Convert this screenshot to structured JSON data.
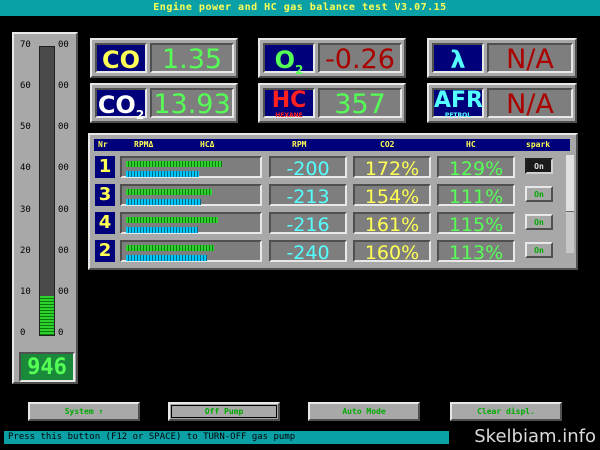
{
  "window": {
    "title": "Engine power and HC gas balance test  V3.07.15"
  },
  "gauge": {
    "left_ticks": [
      "70",
      "60",
      "50",
      "40",
      "30",
      "20",
      "10",
      "0"
    ],
    "right_ticks": [
      "00",
      "00",
      "00",
      "00",
      "00",
      "00",
      "00",
      "0"
    ],
    "readout": "946",
    "fill_fraction": 0.135
  },
  "readings": {
    "co": {
      "symbol": "CO",
      "value": "1.35"
    },
    "o2": {
      "symbol": "O",
      "sub": "2",
      "value": "-0.26"
    },
    "lambda": {
      "symbol": "λ",
      "value": "N/A"
    },
    "co2": {
      "symbol": "CO",
      "sub": "2",
      "value": "13.93"
    },
    "hc": {
      "symbol": "HC",
      "sub": "HEXANE",
      "value": "357"
    },
    "afr": {
      "symbol": "AFR",
      "sub": "PETROL",
      "value": "N/A"
    }
  },
  "table": {
    "headers": {
      "nr": "Nr",
      "rpm_delta": "RPMΔ",
      "hc_delta": "HCΔ",
      "rpm": "RPM",
      "co2": "CO2",
      "hc": "HC",
      "spark": "spark"
    },
    "rows": [
      {
        "nr": "1",
        "rpm": "-200",
        "co2": "172%",
        "hc": "129%",
        "spark": "On",
        "bar_rpm": 0.74,
        "bar_hc": 0.56,
        "active": true
      },
      {
        "nr": "3",
        "rpm": "-213",
        "co2": "154%",
        "hc": "111%",
        "spark": "On",
        "bar_rpm": 0.66,
        "bar_hc": 0.58,
        "active": false
      },
      {
        "nr": "4",
        "rpm": "-216",
        "co2": "161%",
        "hc": "115%",
        "spark": "On",
        "bar_rpm": 0.71,
        "bar_hc": 0.55,
        "active": false
      },
      {
        "nr": "2",
        "rpm": "-240",
        "co2": "160%",
        "hc": "113%",
        "spark": "On",
        "bar_rpm": 0.68,
        "bar_hc": 0.62,
        "active": false
      }
    ]
  },
  "buttons": {
    "system": "System ↑",
    "off_pump": "Off Pump",
    "auto_mode": "Auto Mode",
    "clear_display": "Clear displ."
  },
  "status": "Press this button (F12 or SPACE) to TURN-OFF gas pump",
  "watermark": "Skelbiam.info",
  "colors": {
    "title_bar": "#0aa0a6",
    "value_green": "#55ff55",
    "value_red": "#aa0000",
    "value_yellow": "#ffff55",
    "value_cyan": "#55ffff"
  }
}
